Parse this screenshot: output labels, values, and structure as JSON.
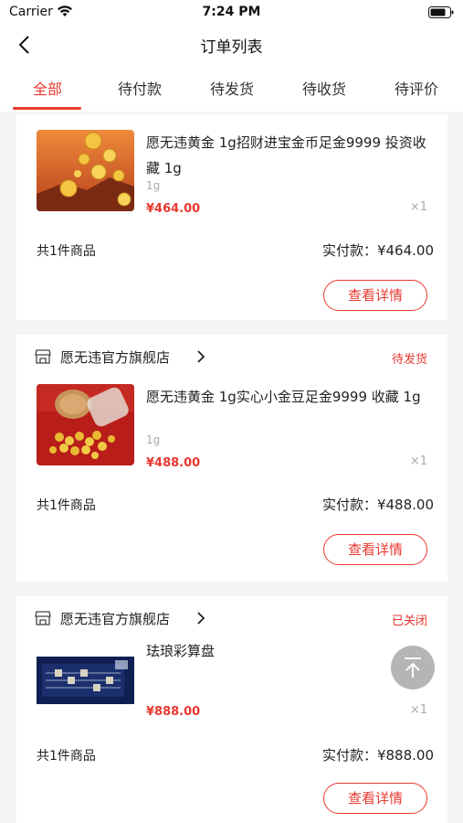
{
  "status_bar": {
    "carrier": "Carrier",
    "time": "7:24 PM"
  },
  "nav": {
    "title": "订单列表"
  },
  "tabs": [
    {
      "label": "全部",
      "active": true
    },
    {
      "label": "待付款",
      "active": false
    },
    {
      "label": "待发货",
      "active": false
    },
    {
      "label": "待收货",
      "active": false
    },
    {
      "label": "待评价",
      "active": false
    }
  ],
  "orders": [
    {
      "shop": "",
      "status": "",
      "product": {
        "title": "愿无违黄金 1g招财进宝金币足金9999 投资收藏 1g",
        "spec": "1g",
        "price": "¥464.00",
        "qty": "×1",
        "thumb_icon": "gold-coins-image"
      },
      "count_text": "共1件商品",
      "paid_text": "实付款：¥464.00",
      "button": "查看详情"
    },
    {
      "shop": "愿无违官方旗舰店",
      "status": "待发货",
      "product": {
        "title": "愿无违黄金 1g实心小金豆足金9999 收藏 1g",
        "spec": "1g",
        "price": "¥488.00",
        "qty": "×1",
        "thumb_icon": "gold-beans-image"
      },
      "count_text": "共1件商品",
      "paid_text": "实付款：¥488.00",
      "button": "查看详情"
    },
    {
      "shop": "愿无违官方旗舰店",
      "status": "已关闭",
      "product": {
        "title": "珐琅彩算盘",
        "spec": "",
        "price": "¥888.00",
        "qty": "×1",
        "thumb_icon": "abacus-image"
      },
      "count_text": "共1件商品",
      "paid_text": "实付款：¥888.00",
      "button": "查看详情"
    }
  ],
  "colors": {
    "accent": "#e8382f",
    "background": "#f5f5f5",
    "muted": "#aaaaaa"
  }
}
